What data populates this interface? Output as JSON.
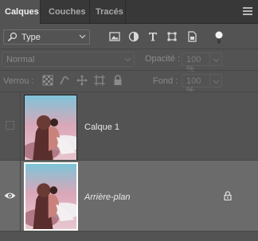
{
  "tabs": [
    {
      "label": "Calques",
      "active": true
    },
    {
      "label": "Couches",
      "active": false
    },
    {
      "label": "Tracés",
      "active": false
    }
  ],
  "filter": {
    "kind_label": "Type",
    "icons": [
      "image-filter-icon",
      "adjustment-filter-icon",
      "type-filter-icon",
      "shape-filter-icon",
      "smart-object-filter-icon"
    ]
  },
  "blend": {
    "mode": "Normal",
    "opacity_label": "Opacité :",
    "opacity_value": "100 %",
    "lock_label": "Verrou :",
    "fill_label": "Fond :",
    "fill_value": "100 %"
  },
  "layers": [
    {
      "name": "Calque 1",
      "visible": false,
      "selected": false,
      "locked": false
    },
    {
      "name": "Arrière-plan",
      "visible": true,
      "selected": true,
      "locked": true
    }
  ],
  "colors": {
    "panel_bg": "#535353",
    "tab_bar_bg": "#383838",
    "selected_row_bg": "#6b6b6b"
  }
}
